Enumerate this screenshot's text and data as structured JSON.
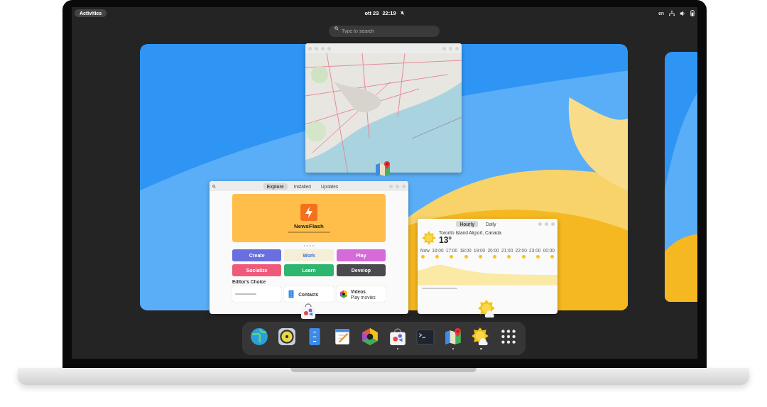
{
  "top_bar": {
    "activities_button": "Activities",
    "date": "ott 23",
    "time": "22:19",
    "keyboard_layout": "en"
  },
  "search": {
    "placeholder": "Type to search"
  },
  "windows": [
    {
      "kind": "maps"
    },
    {
      "kind": "software",
      "tabs": [
        {
          "label": "Explore",
          "selected": true
        },
        {
          "label": "Installed",
          "selected": false
        },
        {
          "label": "Updates",
          "selected": false
        }
      ],
      "banner_title": "NewsFlash",
      "categories": [
        {
          "label": "Create",
          "color": "#6a6fe0"
        },
        {
          "label": "Work",
          "color": "#f5efd8"
        },
        {
          "label": "Play",
          "color": "#d56ad8"
        },
        {
          "label": "Socialize",
          "color": "#ef5a7a"
        },
        {
          "label": "Learn",
          "color": "#2eb56e"
        },
        {
          "label": "Develop",
          "color": "#4a4a4e"
        }
      ],
      "section_title": "Editor's Choice",
      "featured": [
        {
          "name": "Contacts"
        },
        {
          "name": "Videos",
          "subtitle": "Play movies"
        }
      ]
    },
    {
      "kind": "weather",
      "tabs": [
        {
          "label": "Hourly",
          "selected": true
        },
        {
          "label": "Daily",
          "selected": false
        }
      ],
      "location": "Toronto Island Airport, Canada",
      "temperature": "13°",
      "hours": [
        "Now",
        "16:00",
        "17:00",
        "18:00",
        "19:00",
        "20:00",
        "21:00",
        "22:00",
        "23:00",
        "00:00"
      ]
    }
  ],
  "dock": [
    {
      "kind": "browser",
      "running": false
    },
    {
      "kind": "sound",
      "running": false
    },
    {
      "kind": "files",
      "running": false
    },
    {
      "kind": "editor",
      "running": false
    },
    {
      "kind": "photos",
      "running": false
    },
    {
      "kind": "software",
      "running": true
    },
    {
      "kind": "terminal",
      "running": false
    },
    {
      "kind": "maps",
      "running": true
    },
    {
      "kind": "weather",
      "running": true
    },
    {
      "kind": "grid",
      "running": false
    }
  ]
}
